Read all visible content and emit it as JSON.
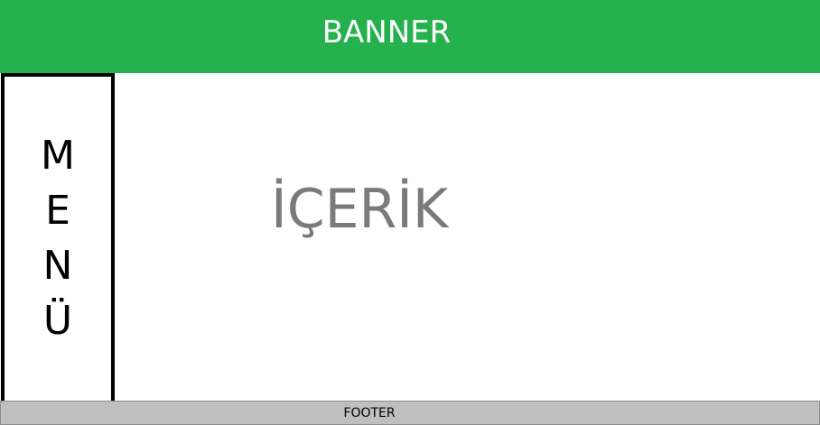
{
  "banner": {
    "title": "BANNER",
    "color": "#24b14e"
  },
  "menu": {
    "letters": [
      "M",
      "E",
      "N",
      "Ü"
    ],
    "border_color": "#000000"
  },
  "content": {
    "text": "İÇERİK",
    "color": "#7a7a7a"
  },
  "footer": {
    "text": "FOOTER",
    "color": "#bfbfbf"
  }
}
